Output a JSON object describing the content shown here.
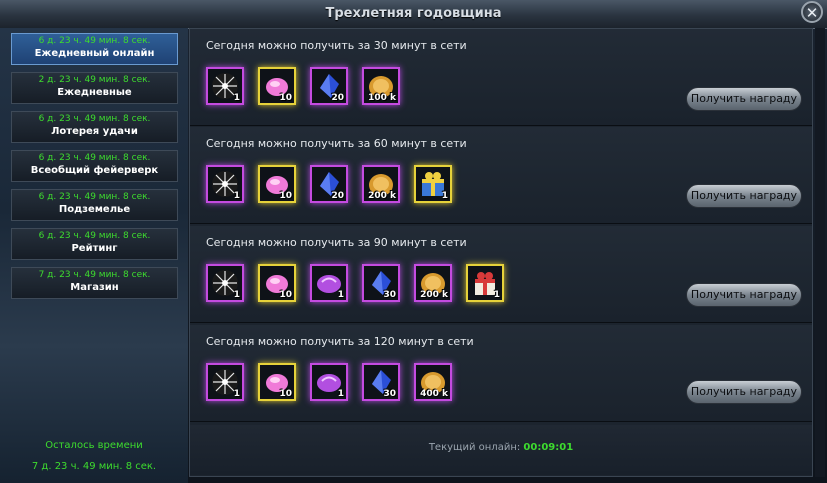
{
  "window": {
    "title": "Трехлетняя годовщина",
    "close_glyph": "✕"
  },
  "sidebar": {
    "items": [
      {
        "timer": "6 д. 23 ч. 49 мин. 8 сек.",
        "label": "Ежедневный онлайн",
        "active": true
      },
      {
        "timer": "2 д. 23 ч. 49 мин. 8 сек.",
        "label": "Ежедневные"
      },
      {
        "timer": "6 д. 23 ч. 49 мин. 8 сек.",
        "label": "Лотерея удачи"
      },
      {
        "timer": "6 д. 23 ч. 49 мин. 8 сек.",
        "label": "Всеобщий фейерверк"
      },
      {
        "timer": "6 д. 23 ч. 49 мин. 8 сек.",
        "label": "Подземелье"
      },
      {
        "timer": "6 д. 23 ч. 49 мин. 8 сек.",
        "label": "Рейтинг"
      },
      {
        "timer": "7 д. 23 ч. 49 мин. 8 сек.",
        "label": "Магазин"
      }
    ],
    "remaining_label": "Осталось времени",
    "remaining_time": "7 д. 23 ч. 49 мин. 8 сек."
  },
  "rewards": [
    {
      "title": "Сегодня можно получить за 30 минут в сети",
      "button": "Получить награду",
      "items": [
        {
          "icon": "firework-icon",
          "qty": "1",
          "frame": "purple"
        },
        {
          "icon": "pink-gem-icon",
          "qty": "10",
          "frame": "yellow"
        },
        {
          "icon": "blue-crystal-icon",
          "qty": "20",
          "frame": "purple"
        },
        {
          "icon": "gold-coin-icon",
          "qty": "100 k",
          "frame": "purple"
        }
      ]
    },
    {
      "title": "Сегодня можно получить за 60 минут в сети",
      "button": "Получить награду",
      "items": [
        {
          "icon": "firework-icon",
          "qty": "1",
          "frame": "purple"
        },
        {
          "icon": "pink-gem-icon",
          "qty": "10",
          "frame": "yellow"
        },
        {
          "icon": "blue-crystal-icon",
          "qty": "20",
          "frame": "purple"
        },
        {
          "icon": "gold-coin-icon",
          "qty": "200 k",
          "frame": "purple"
        },
        {
          "icon": "blue-gift-icon",
          "qty": "1",
          "frame": "yellow"
        }
      ]
    },
    {
      "title": "Сегодня можно получить за 90 минут в сети",
      "button": "Получить награду",
      "items": [
        {
          "icon": "firework-icon",
          "qty": "1",
          "frame": "purple"
        },
        {
          "icon": "pink-gem-icon",
          "qty": "10",
          "frame": "yellow"
        },
        {
          "icon": "purple-stone-icon",
          "qty": "1",
          "frame": "purple"
        },
        {
          "icon": "blue-crystal-icon",
          "qty": "30",
          "frame": "purple"
        },
        {
          "icon": "gold-coin-icon",
          "qty": "200 k",
          "frame": "purple"
        },
        {
          "icon": "red-gift-icon",
          "qty": "1",
          "frame": "yellow"
        }
      ]
    },
    {
      "title": "Сегодня можно получить за 120 минут в сети",
      "button": "Получить награду",
      "items": [
        {
          "icon": "firework-icon",
          "qty": "1",
          "frame": "purple"
        },
        {
          "icon": "pink-gem-icon",
          "qty": "10",
          "frame": "yellow"
        },
        {
          "icon": "purple-stone-icon",
          "qty": "1",
          "frame": "purple"
        },
        {
          "icon": "blue-crystal-icon",
          "qty": "30",
          "frame": "purple"
        },
        {
          "icon": "gold-coin-icon",
          "qty": "400 k",
          "frame": "purple"
        }
      ]
    }
  ],
  "footer": {
    "online_label": "Текущий онлайн:",
    "online_value": "00:09:01"
  },
  "colors": {
    "accent_green": "#3ddc2e",
    "frame_purple": "#c44be0",
    "frame_yellow": "#e6d23a",
    "active_tab": "#2f5f98"
  }
}
